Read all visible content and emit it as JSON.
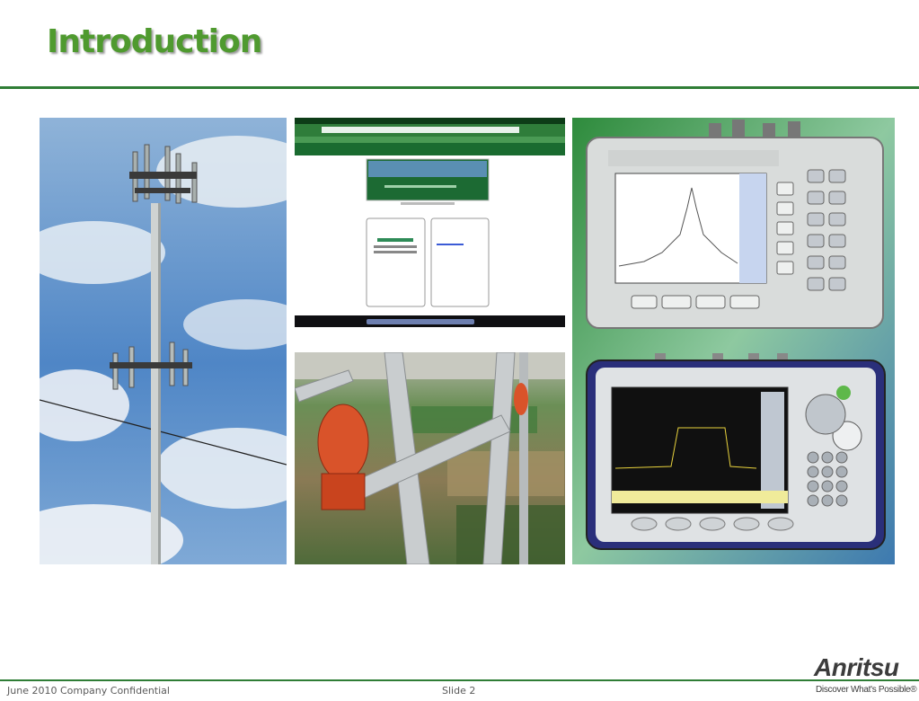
{
  "slide": {
    "title": "Introduction",
    "footer_left": "June 2010 Company Confidential",
    "footer_slide": "Slide 2",
    "logo": "Anritsu",
    "tagline": "Discover What's Possible®"
  },
  "colors": {
    "title_green": "#4f9a2f",
    "rule_green": "#2f7d36",
    "footer_text": "#5a5a5a"
  },
  "images": [
    {
      "name": "cell-tower-photo",
      "depicts": "cell tower with antennas against blue sky"
    },
    {
      "name": "sweepmasters-website-screenshot",
      "depicts": "web browser showing Sweepmasters site"
    },
    {
      "name": "tower-climbing-photo",
      "depicts": "view from tower climb with red obstruction light"
    },
    {
      "name": "sitemaster-instruments-photo",
      "depicts": "two Anritsu handheld analyzers"
    }
  ]
}
